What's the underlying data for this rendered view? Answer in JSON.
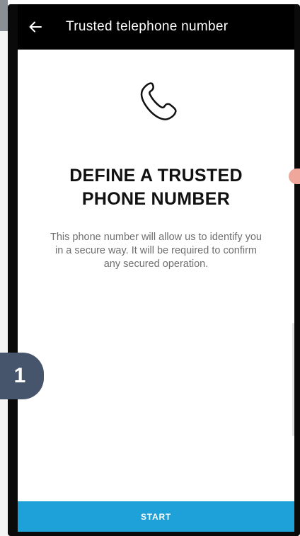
{
  "topbar": {
    "back_icon": "arrow-left-icon",
    "title": "Trusted telephone number"
  },
  "main": {
    "illustration_icon": "phone-icon",
    "headline_line1": "DEFINE A TRUSTED",
    "headline_line2": "PHONE NUMBER",
    "description": "This phone number will allow us to identify you in a secure way. It will be required to confirm any secured operation."
  },
  "footer": {
    "start_label": "START"
  },
  "overlay": {
    "step_number": "1"
  },
  "colors": {
    "topbar_bg": "#000000",
    "start_button": "#1ea0d8",
    "step_badge": "#46556b",
    "text_muted": "#6e6e6e"
  }
}
